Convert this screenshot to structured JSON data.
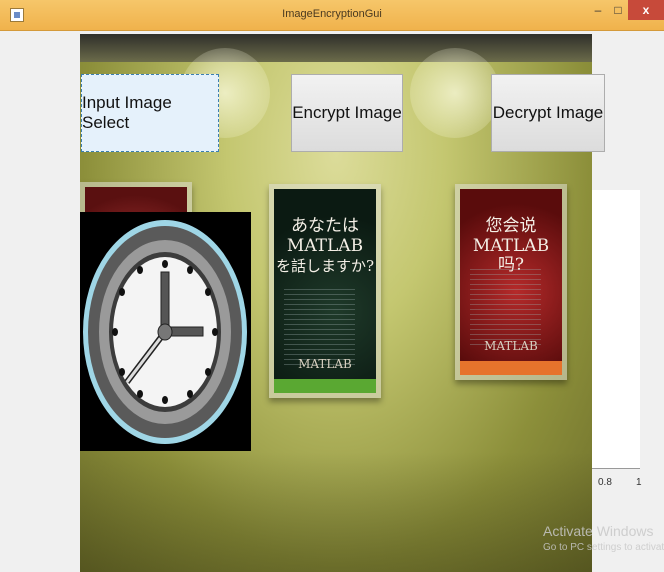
{
  "window": {
    "title": "ImageEncryptionGui",
    "min_glyph": "–",
    "max_glyph": "□",
    "close_glyph": "x"
  },
  "buttons": {
    "input": "Input Image Select",
    "encrypt": "Encrypt Image",
    "decrypt": "Decrypt Image"
  },
  "posters": {
    "jp_line1": "あなたは",
    "jp_line2": "MATLAB",
    "jp_line3": "を話しますか?",
    "jp_footer": "MATLAB",
    "cn_line1": "您会说",
    "cn_line2": "MATLAB吗?",
    "cn_footer": "MATLAB"
  },
  "axes": {
    "tick_labels": [
      "0.8",
      "1"
    ]
  },
  "watermark": {
    "line1": "Activate Windows",
    "line2": "Go to PC settings to activate W"
  },
  "colors": {
    "title_bar": "#f0b24c",
    "close_button": "#c74a3a",
    "focus_button": "#e5f1fb",
    "wall": "#c4c770"
  },
  "icons": [
    "app-icon",
    "minimize-icon",
    "maximize-icon",
    "close-icon",
    "clock-image"
  ]
}
